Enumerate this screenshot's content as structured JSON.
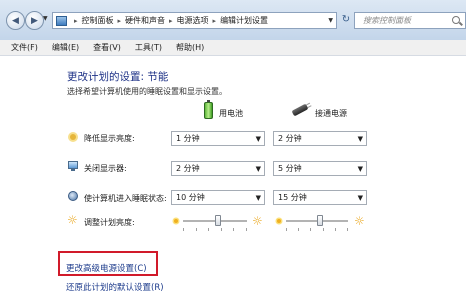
{
  "address_bar": {
    "breadcrumbs": [
      "控制面板",
      "硬件和声音",
      "电源选项",
      "编辑计划设置"
    ],
    "search_placeholder": "搜索控制面板"
  },
  "menu": [
    "文件(F)",
    "编辑(E)",
    "查看(V)",
    "工具(T)",
    "帮助(H)"
  ],
  "page": {
    "title": "更改计划的设置: 节能",
    "description": "选择希望计算机使用的睡眠设置和显示设置。"
  },
  "columns": {
    "battery": "用电池",
    "plugged_in": "接通电源"
  },
  "settings": [
    {
      "label": "降低显示亮度:",
      "icon": "dim-display-icon",
      "battery": "1 分钟",
      "plugged_in": "2 分钟"
    },
    {
      "label": "关闭显示器:",
      "icon": "monitor-icon",
      "battery": "2 分钟",
      "plugged_in": "5 分钟"
    },
    {
      "label": "使计算机进入睡眠状态:",
      "icon": "sleep-moon-icon",
      "battery": "10 分钟",
      "plugged_in": "15 分钟"
    }
  ],
  "brightness": {
    "label": "调整计划亮度:",
    "battery_level": 0.55,
    "plugged_in_level": 0.55
  },
  "links": {
    "advanced": "更改高级电源设置(C)",
    "restore": "还原此计划的默认设置(R)"
  },
  "colors": {
    "highlight_border": "#d11a2a",
    "link": "#1e3c8c",
    "title": "#1e3287"
  }
}
